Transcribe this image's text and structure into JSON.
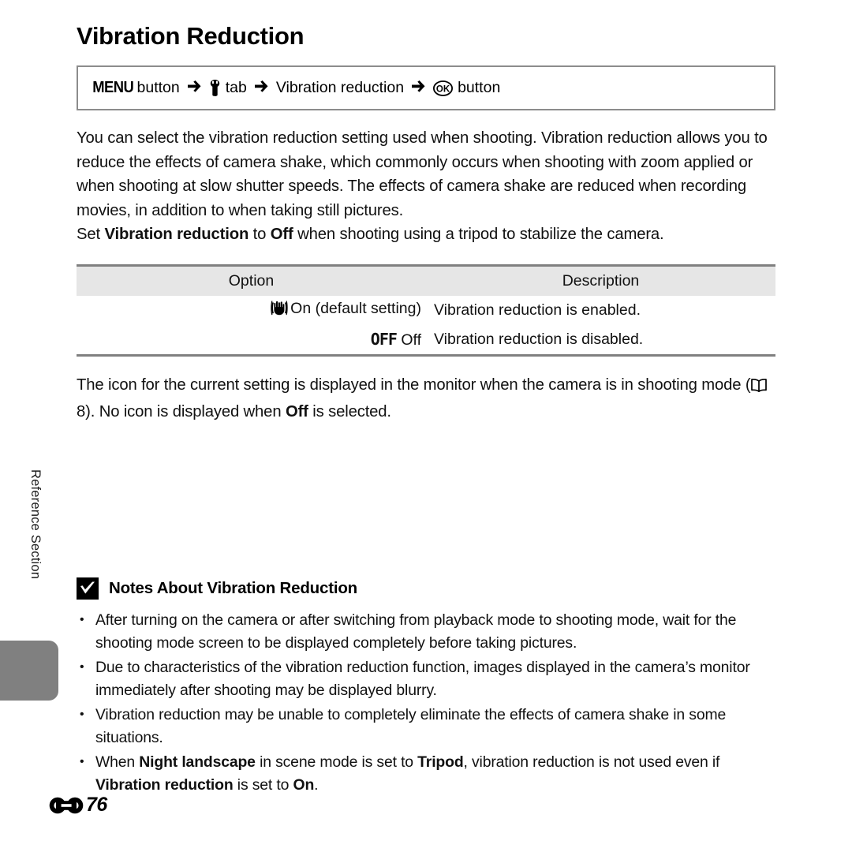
{
  "page": {
    "title": "Vibration Reduction",
    "footer_marker_icon": "reference-section-glyph",
    "footer_page_number": "76",
    "side_tab_label": "Reference Section"
  },
  "breadcrumb": {
    "menu_label": "MENU",
    "button_word_1": "button",
    "arrow": "➜",
    "wrench_icon": "wrench-icon",
    "tab_word": "tab",
    "setting_name": "Vibration reduction",
    "ok_icon": "ok-button-icon",
    "button_word_2": "button"
  },
  "body": {
    "intro_paragraph": "You can select the vibration reduction setting used when shooting. Vibration reduction allows you to reduce the effects of camera shake, which commonly occurs when shooting with zoom applied or when shooting at slow shutter speeds. The effects of camera shake are reduced when recording movies, in addition to when taking still pictures.",
    "tripod_line": {
      "prefix": "Set ",
      "bold_1": "Vibration reduction",
      "middle": " to ",
      "bold_2": "Off",
      "suffix": " when shooting using a tripod to stabilize the camera."
    },
    "after_table": {
      "line_1": "The icon for the current setting is displayed in the monitor when the camera is in shooting",
      "mode_word": "mode (",
      "book_icon": "book-icon",
      "page_ref": " 8). No icon is displayed when ",
      "bold_off": "Off",
      "tail": " is selected."
    }
  },
  "table": {
    "headers": [
      "Option",
      "Description"
    ],
    "rows": [
      {
        "icon": "vibration-hand-icon",
        "option": "On (default setting)",
        "description": "Vibration reduction is enabled."
      },
      {
        "icon": "off-glyph",
        "off_glyph_text": "OFF",
        "option": "Off",
        "description": "Vibration reduction is disabled."
      }
    ]
  },
  "notes": {
    "icon": "checkmark-box-icon",
    "title": "Notes About Vibration Reduction",
    "items": [
      {
        "segments": [
          {
            "text": "After turning on the camera or after switching from playback mode to shooting mode, wait for the shooting mode screen to be displayed completely before taking pictures.",
            "bold": false
          }
        ]
      },
      {
        "segments": [
          {
            "text": "Due to characteristics of the vibration reduction function, images displayed in the camera’s monitor immediately after shooting may be displayed blurry.",
            "bold": false
          }
        ]
      },
      {
        "segments": [
          {
            "text": "Vibration reduction may be unable to completely eliminate the effects of camera shake in some situations.",
            "bold": false
          }
        ]
      },
      {
        "segments": [
          {
            "text": "When ",
            "bold": false
          },
          {
            "text": "Night landscape",
            "bold": true
          },
          {
            "text": " in scene mode is set to ",
            "bold": false
          },
          {
            "text": "Tripod",
            "bold": true
          },
          {
            "text": ", vibration reduction is not used even if ",
            "bold": false
          },
          {
            "text": "Vibration reduction",
            "bold": true
          },
          {
            "text": " is set to ",
            "bold": false
          },
          {
            "text": "On",
            "bold": true
          },
          {
            "text": ".",
            "bold": false
          }
        ]
      }
    ]
  },
  "colors": {
    "side_tab_gray": "#808080",
    "table_header_gray": "#e6e6e6",
    "rule_gray": "#808080",
    "box_border_gray": "#8c8c8c"
  }
}
